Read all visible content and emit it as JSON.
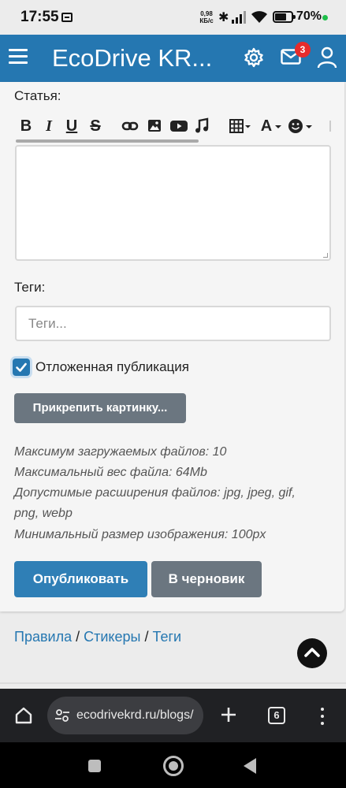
{
  "status_bar": {
    "time": "17:55",
    "net_speed_value": "0,98",
    "net_speed_unit": "КБ/с",
    "battery_percent": "70%",
    "battery_level": 0.7,
    "bluetooth_glyph": "✱"
  },
  "header": {
    "title": "EcoDrive KR...",
    "notifications_count": "3",
    "icons": [
      "menu-icon",
      "settings-icon",
      "mail-icon",
      "user-icon"
    ],
    "color": "#2577b1"
  },
  "form": {
    "article_label": "Статья:",
    "toolbar": {
      "bold": "B",
      "italic": "I",
      "underline": "U",
      "strike": "S",
      "font_color": "A",
      "icons": [
        "bold-icon",
        "italic-icon",
        "underline-icon",
        "strikethrough-icon",
        "link-icon",
        "image-icon",
        "video-icon",
        "music-icon",
        "table-icon",
        "font-color-icon",
        "emoji-icon"
      ]
    },
    "article_value": "",
    "tags_label": "Теги:",
    "tags_placeholder": "Теги...",
    "delay_checked": true,
    "delay_label": "Отложенная публикация",
    "attach_button": "Прикрепить картинку...",
    "upload_info": {
      "max_files": "Максимум загружаемых файлов: 10",
      "max_size": "Максимальный вес файла: 64Mb",
      "extensions_line1": "Допустимые расширения файлов: jpg, jpeg, gif,",
      "extensions_line2": "png, webp",
      "min_size": "Минимальный размер изображения: 100px"
    },
    "publish_button": "Опубликовать",
    "draft_button": "В черновик"
  },
  "footer": {
    "links": [
      "Правила",
      "Стикеры",
      "Теги"
    ],
    "separator": " / "
  },
  "browser": {
    "url": "ecodrivekrd.ru/blogs/",
    "tabs_count": "6"
  }
}
